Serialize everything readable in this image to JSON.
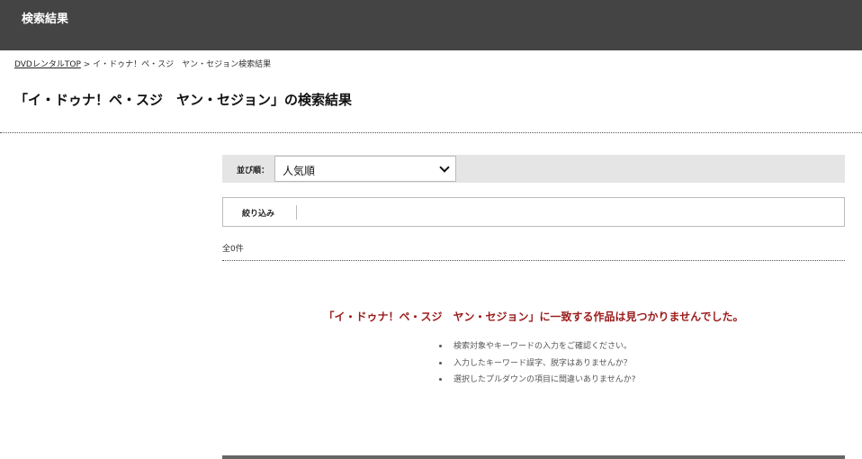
{
  "header": {
    "title": "検索結果"
  },
  "breadcrumb": {
    "top_link": "DVDレンタルTOP",
    "separator": " > ",
    "current": "イ・ドゥナ！ペ・スジ　ヤン・セジョン検索結果"
  },
  "page_title": "「イ・ドゥナ！ペ・スジ　ヤン・セジョン」の検索結果",
  "sort": {
    "label": "並び順：",
    "selected": "人気順"
  },
  "filter": {
    "label": "絞り込み"
  },
  "result_count": "全0件",
  "no_results": {
    "message": "「イ・ドゥナ！ペ・スジ　ヤン・セジョン」に一致する作品は見つかりませんでした。",
    "tips": [
      "検索対象やキーワードの入力をご確認ください。",
      "入力したキーワード誤字、脱字はありませんか？",
      "選択したプルダウンの項目に間違いありませんか?"
    ]
  },
  "colors": {
    "header_bg": "#444444",
    "sort_bar_bg": "#e5e5e5",
    "error_text": "#9b1c1c"
  }
}
